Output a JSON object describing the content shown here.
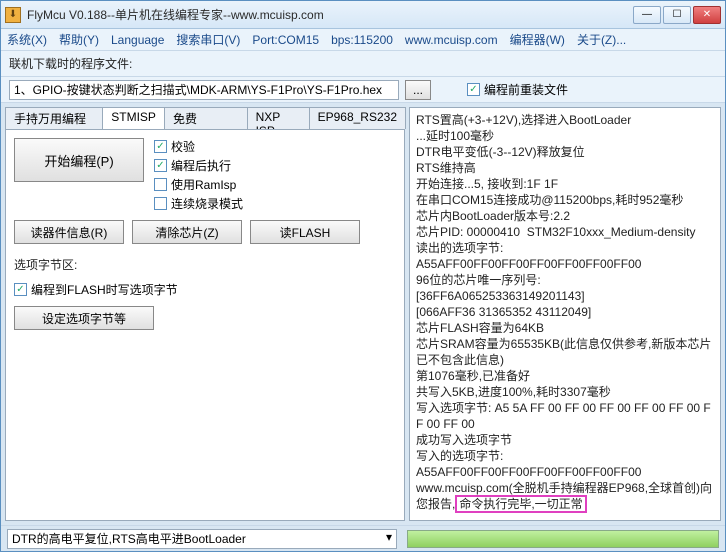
{
  "title": "FlyMcu V0.188--单片机在线编程专家--www.mcuisp.com",
  "menu": {
    "system": "系统(X)",
    "help": "帮助(Y)",
    "language": "Language",
    "search_port": "搜索串口(V)",
    "port": "Port:COM15",
    "bps": "bps:115200",
    "site": "www.mcuisp.com",
    "programmer": "编程器(W)",
    "about": "关于(Z)..."
  },
  "toolbar": {
    "path_label": "联机下载时的程序文件:",
    "path_value": "1、GPIO-按键状态判断之扫描式\\MDK-ARM\\YS-F1Pro\\YS-F1Pro.hex",
    "browse": "...",
    "reload_chk": "编程前重装文件"
  },
  "tabs": {
    "t0": "手持万用编程器",
    "t1": "STMISP",
    "t2": "免费STMIAP",
    "t3": "NXP ISP",
    "t4": "EP968_RS232"
  },
  "panel": {
    "start": "开始编程(P)",
    "verify": "校验",
    "run_after": "编程后执行",
    "use_ramisp": "使用RamIsp",
    "cont_prog": "连续烧录模式",
    "read_info": "读器件信息(R)",
    "erase": "清除芯片(Z)",
    "read_flash": "读FLASH",
    "section_label": "选项字节区:",
    "write_opt_chk": "编程到FLASH时写选项字节",
    "set_opt_btn": "设定选项字节等"
  },
  "log": {
    "lines": [
      "RTS置高(+3-+12V),选择进入BootLoader",
      "...延时100毫秒",
      "DTR电平变低(-3--12V)释放复位",
      "RTS维持高",
      "开始连接...5, 接收到:1F 1F",
      "在串口COM15连接成功@115200bps,耗时952毫秒",
      "芯片内BootLoader版本号:2.2",
      "芯片PID: 00000410  STM32F10xxx_Medium-density",
      "读出的选项字节:",
      "A55AFF00FF00FF00FF00FF00FF00FF00",
      "96位的芯片唯一序列号:",
      "[36FF6A065253363149201143]",
      "[066AFF36 31365352 43112049]",
      "芯片FLASH容量为64KB",
      "芯片SRAM容量为65535KB(此信息仅供参考,新版本芯片已不包含此信息)",
      "第1076毫秒,已准备好",
      "共写入5KB,进度100%,耗时3307毫秒",
      "写入选项字节: A5 5A FF 00 FF 00 FF 00 FF 00 FF 00 FF 00 FF 00",
      "成功写入选项字节",
      "写入的选项字节:",
      "A55AFF00FF00FF00FF00FF00FF00FF00"
    ],
    "final_prefix": "www.mcuisp.com(全脱机手持编程器EP968,全球首创)向您报告,",
    "final_highlight": "命令执行完毕,一切正常"
  },
  "footer": {
    "combo": "DTR的高电平复位,RTS高电平进BootLoader"
  }
}
